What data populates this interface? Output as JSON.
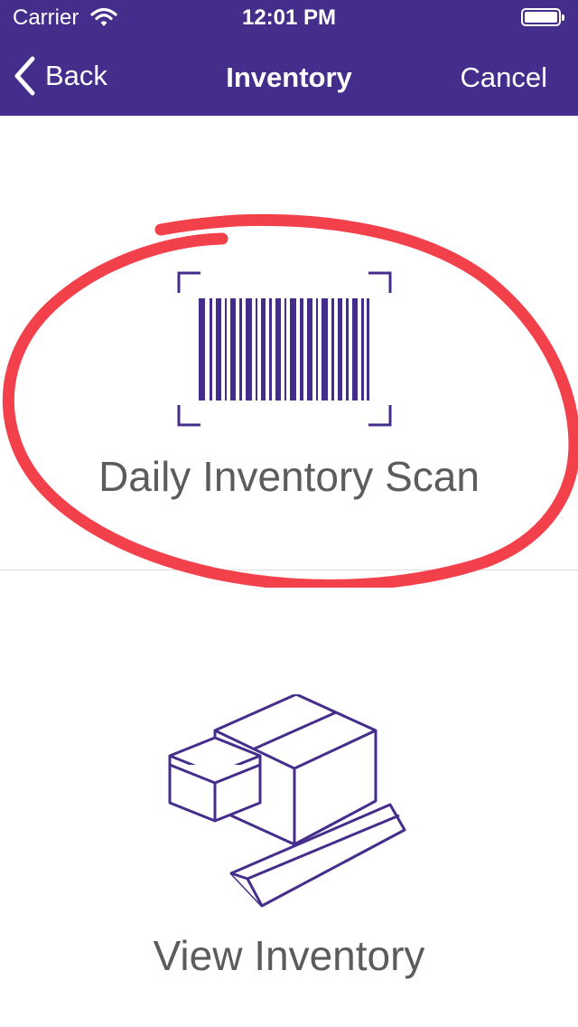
{
  "status_bar": {
    "carrier": "Carrier",
    "time": "12:01 PM",
    "icons": [
      "wifi-icon",
      "battery-icon"
    ]
  },
  "nav": {
    "back_label": "Back",
    "title": "Inventory",
    "cancel_label": "Cancel"
  },
  "options": [
    {
      "label": "Daily Inventory Scan",
      "icon": "barcode-scan-icon"
    },
    {
      "label": "View Inventory",
      "icon": "boxes-icon"
    }
  ],
  "colors": {
    "header": "#452d8c",
    "icon": "#452d8c",
    "label_text": "#5c5c5c",
    "annotation": "#f2414b"
  }
}
